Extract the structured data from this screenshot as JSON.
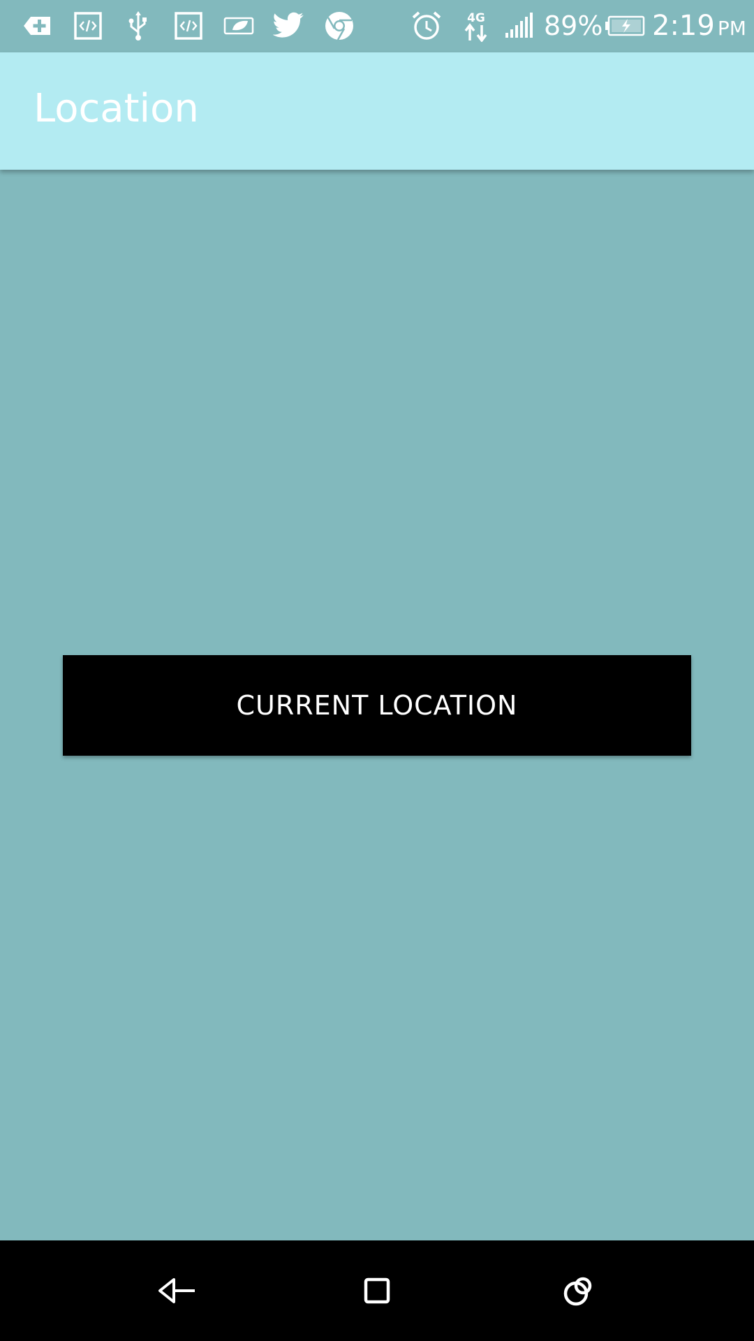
{
  "status_bar": {
    "icons": [
      "add-tab-icon",
      "code-icon",
      "usb-icon",
      "code-icon",
      "battery-saver-leaf-icon",
      "twitter-icon",
      "chrome-icon",
      "alarm-icon",
      "4g-data-icon",
      "signal-strength-icon",
      "battery-charging-icon"
    ],
    "network_label": "4G",
    "battery_percent": "89%",
    "time": "2:19",
    "ampm": "PM"
  },
  "app_bar": {
    "title": "Location",
    "background": "#b3ebf2"
  },
  "main": {
    "current_location_button": "CURRENT LOCATION",
    "background": "#82b9bd"
  },
  "nav_bar": {
    "buttons": [
      "back-icon",
      "home-icon",
      "recents-icon"
    ]
  }
}
